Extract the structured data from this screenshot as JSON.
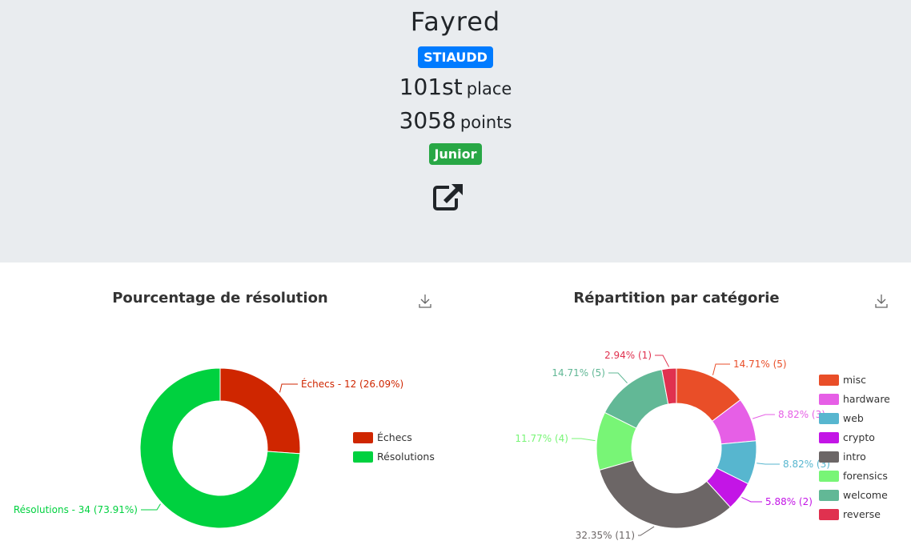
{
  "profile": {
    "name": "Fayred",
    "team": "STIAUDD",
    "place_number": "101st",
    "place_word": "place",
    "points_number": "3058",
    "points_word": "points",
    "league": "Junior",
    "team_color": "#007bff",
    "league_color": "#28a745"
  },
  "icons": {
    "external_link": "external-link-icon",
    "download": "download-icon"
  },
  "chart_data": [
    {
      "type": "pie",
      "title": "Pourcentage de résolution",
      "legend_position": "right",
      "categories": [
        "Échecs",
        "Résolutions"
      ],
      "values": [
        12,
        34
      ],
      "percentages": [
        26.09,
        73.91
      ],
      "colors": [
        "#cf2600",
        "#00d13f"
      ],
      "labels": [
        "Échecs - 12 (26.09%)",
        "Résolutions - 34 (73.91%)"
      ]
    },
    {
      "type": "pie",
      "title": "Répartition par catégorie",
      "legend_position": "right",
      "categories": [
        "misc",
        "hardware",
        "web",
        "crypto",
        "intro",
        "forensics",
        "welcome",
        "reverse"
      ],
      "values": [
        5,
        3,
        3,
        2,
        11,
        4,
        5,
        1
      ],
      "percentages": [
        14.71,
        8.82,
        8.82,
        5.88,
        32.35,
        11.77,
        14.71,
        2.94
      ],
      "colors": [
        "#e94e28",
        "#e65fe6",
        "#57b6cf",
        "#c315e6",
        "#6c6666",
        "#78f576",
        "#62b896",
        "#e0314f"
      ],
      "labels": [
        "14.71% (5)",
        "8.82% (3)",
        "8.82% (3)",
        "5.88% (2)",
        "32.35% (11)",
        "11.77% (4)",
        "14.71% (5)",
        "2.94% (1)"
      ]
    }
  ]
}
